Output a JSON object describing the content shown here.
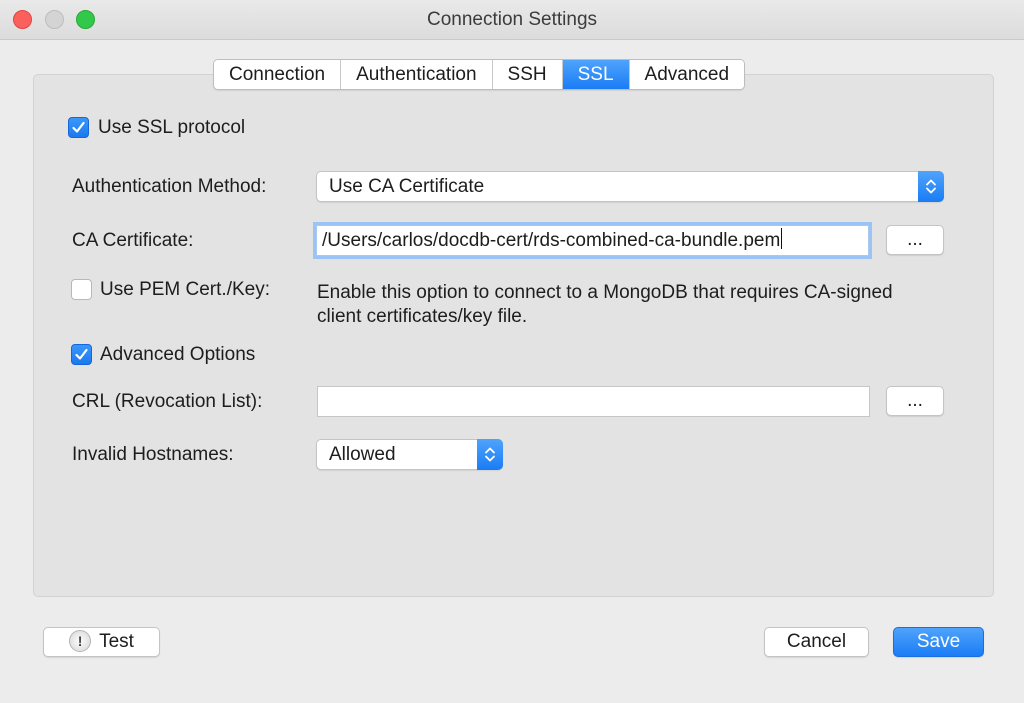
{
  "window": {
    "title": "Connection Settings"
  },
  "tabs": [
    {
      "label": "Connection",
      "active": false
    },
    {
      "label": "Authentication",
      "active": false
    },
    {
      "label": "SSH",
      "active": false
    },
    {
      "label": "SSL",
      "active": true
    },
    {
      "label": "Advanced",
      "active": false
    }
  ],
  "ssl": {
    "use_ssl": {
      "label": "Use SSL protocol",
      "checked": true
    },
    "auth_method": {
      "label": "Authentication Method:",
      "value": "Use CA Certificate"
    },
    "ca_certificate": {
      "label": "CA Certificate:",
      "value": "/Users/carlos/docdb-cert/rds-combined-ca-bundle.pem",
      "browse_label": "..."
    },
    "use_pem": {
      "label": "Use PEM Cert./Key:",
      "checked": false,
      "description": "Enable this option to connect to a MongoDB that requires CA-signed client certificates/key file."
    },
    "advanced_options": {
      "label": "Advanced Options",
      "checked": true
    },
    "crl": {
      "label": "CRL (Revocation List):",
      "value": "",
      "browse_label": "..."
    },
    "invalid_hostnames": {
      "label": "Invalid Hostnames:",
      "value": "Allowed"
    }
  },
  "footer": {
    "test_label": "Test",
    "test_icon": "!",
    "cancel_label": "Cancel",
    "save_label": "Save"
  },
  "colors": {
    "accent": "#1a7cf5",
    "close": "#fc605c",
    "maximize": "#34c84a"
  }
}
